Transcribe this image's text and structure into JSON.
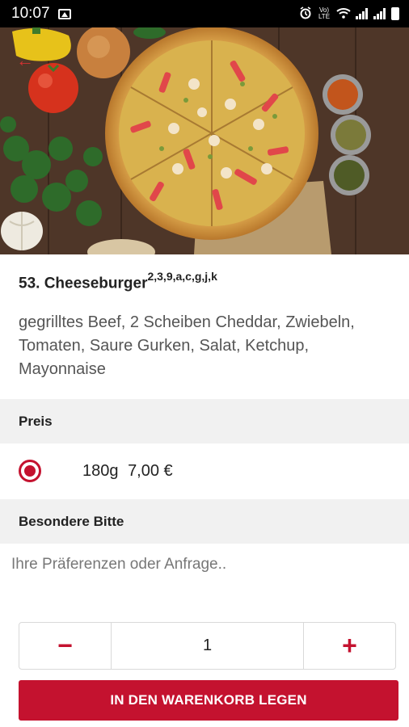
{
  "status_bar": {
    "time": "10:07",
    "network": "Vo) LTE"
  },
  "item": {
    "title": "53. Cheeseburger",
    "allergens": "2,3,9,a,c,g,j,k",
    "description": "gegrilltes Beef, 2 Scheiben Cheddar, Zwiebeln, Tomaten, Saure Gurken, Salat, Ketchup, Mayonnaise"
  },
  "price_section": {
    "label": "Preis",
    "options": [
      {
        "size": "180g",
        "price": "7,00 €",
        "selected": true
      }
    ]
  },
  "request_section": {
    "label": "Besondere Bitte",
    "placeholder": "Ihre Präferenzen oder Anfrage.."
  },
  "quantity": {
    "minus": "−",
    "value": "1",
    "plus": "+"
  },
  "cart_button": {
    "label": "IN DEN WARENKORB LEGEN"
  },
  "colors": {
    "accent": "#c4122f",
    "section_bg": "#f1f1f1"
  },
  "icons": {
    "back": "back-arrow-icon",
    "gallery": "image-icon",
    "alarm": "alarm-icon",
    "wifi": "wifi-icon",
    "signal": "signal-icon",
    "battery": "battery-icon"
  }
}
